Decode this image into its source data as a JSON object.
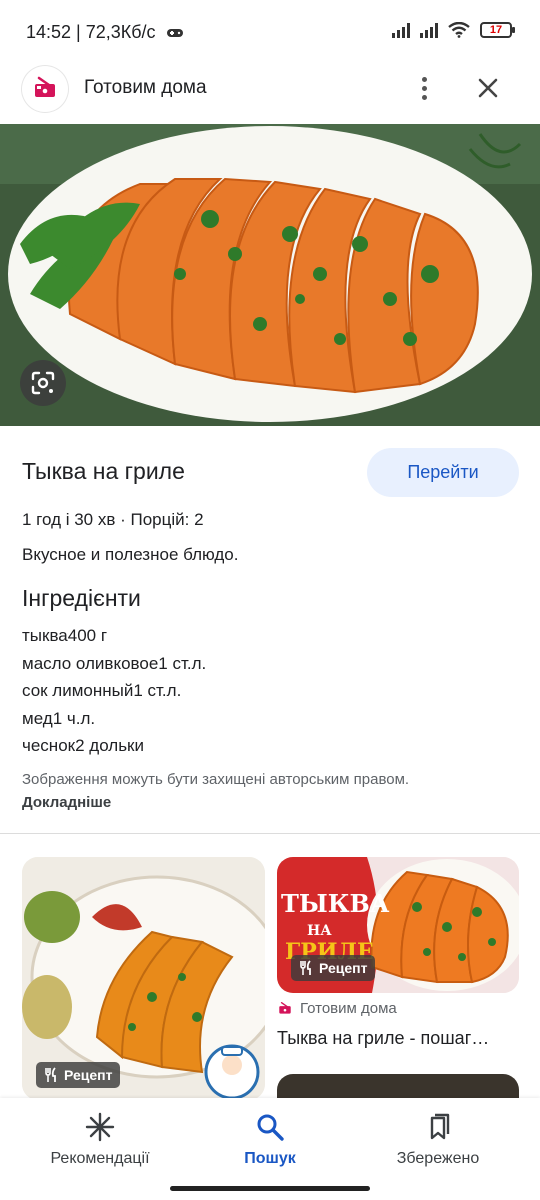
{
  "status": {
    "time_speed": "14:52 | 72,3Кб/с",
    "battery": "17"
  },
  "header": {
    "title": "Готовим дома"
  },
  "recipe": {
    "title": "Тыква на гриле",
    "go_label": "Перейти",
    "meta": "1 год і 30 хв  ·  Порцій: 2",
    "description": "Вкусное и полезное блюдо.",
    "ingredients_title": "Інгредієнти",
    "ingredients": [
      "тыква400 г",
      "масло оливковое1 ст.л.",
      "сок лимонный1 ст.л.",
      "мед1 ч.л.",
      "чеснок2 дольки"
    ],
    "copyright_text": "Зображення можуть бути захищені авторським правом.",
    "copyright_link": "Докладніше"
  },
  "results": {
    "left_badge": "Рецепт",
    "right_badge": "Рецепт",
    "right_source": "Готовим дома",
    "right_title": "Тыква на гриле - пошаг…",
    "right_image_text_1": "ТЫКВА",
    "right_image_text_2": "НА",
    "right_image_text_3": "ГРИЛЕ"
  },
  "bottom_nav": [
    {
      "label": "Рекомендації",
      "icon": "asterisk-icon",
      "active": false
    },
    {
      "label": "Пошук",
      "icon": "search-icon",
      "active": true
    },
    {
      "label": "Збережено",
      "icon": "bookmarks-icon",
      "active": false
    }
  ],
  "colors": {
    "accent": "#1a57c4",
    "go_button_bg": "#e8f0fe",
    "brand_pink": "#d4145a"
  }
}
